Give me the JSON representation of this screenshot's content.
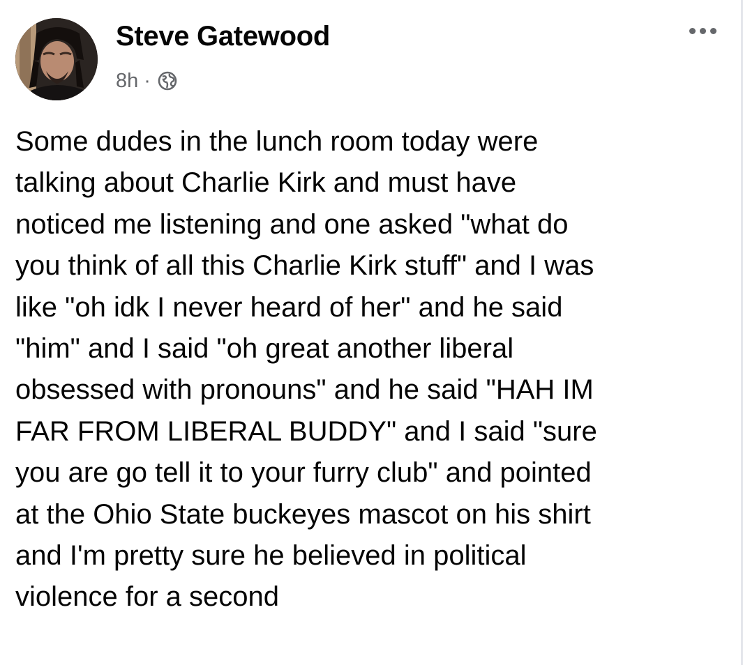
{
  "post": {
    "author": {
      "name": "Steve Gatewood",
      "avatar_icon": "profile-photo"
    },
    "meta": {
      "time": "8h",
      "separator": "·",
      "audience_icon": "globe-icon"
    },
    "menu_icon": "more-options-icon",
    "body_lines": [
      "Some dudes in the lunch room today were",
      "talking about Charlie Kirk and must have",
      "noticed me listening and one asked \"what do",
      "you think of all this Charlie Kirk stuff\" and I was",
      "like \"oh idk I never heard of her\" and he said",
      "\"him\" and I said \"oh great another liberal",
      "obsessed with pronouns\" and he said \"HAH IM",
      "FAR FROM LIBERAL BUDDY\" and I said \"sure",
      "you are go tell it to your furry club\" and pointed",
      "at the Ohio State buckeyes mascot on his shirt",
      "and I'm pretty sure he believed in political",
      "violence for a second"
    ]
  },
  "colors": {
    "text": "#050505",
    "secondary_text": "#65676b",
    "background": "#ffffff"
  }
}
